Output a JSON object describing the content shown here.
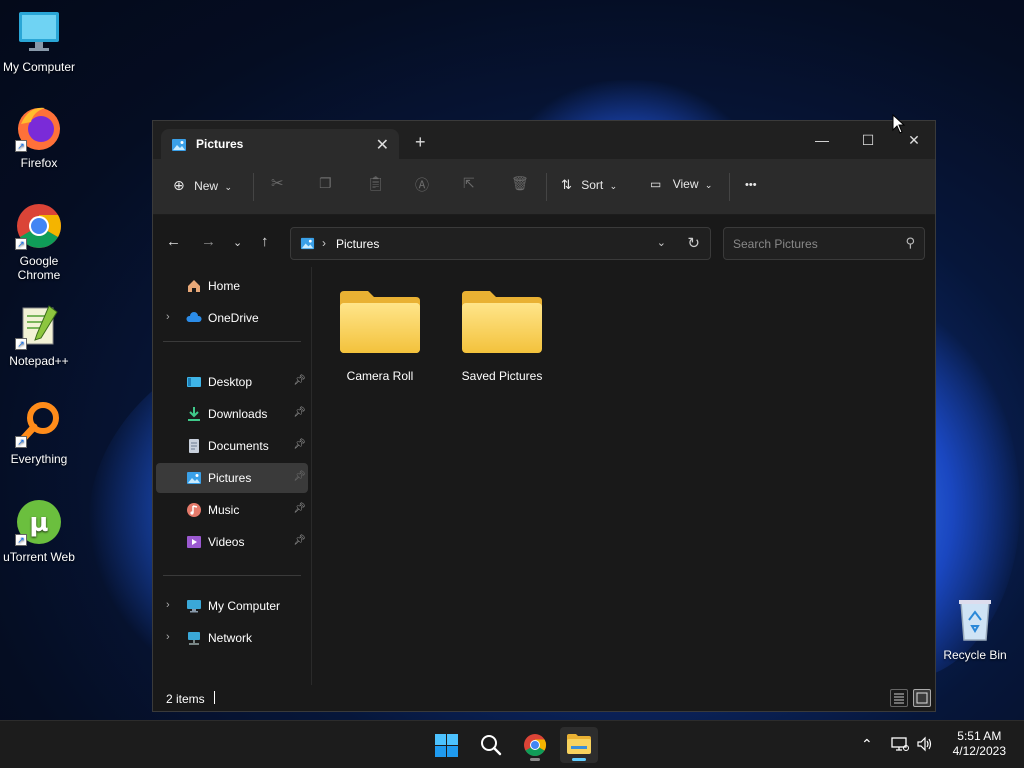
{
  "desktop": {
    "icons": [
      {
        "label": "My Computer"
      },
      {
        "label": "Firefox"
      },
      {
        "label": "Google Chrome"
      },
      {
        "label": "Notepad++"
      },
      {
        "label": "Everything"
      },
      {
        "label": "uTorrent Web"
      },
      {
        "label": "Recycle Bin"
      }
    ]
  },
  "window": {
    "tab_title": "Pictures",
    "toolbar": {
      "new_label": "New",
      "sort_label": "Sort",
      "view_label": "View",
      "more_label": "•••"
    },
    "address": {
      "crumb": "Pictures"
    },
    "search": {
      "placeholder": "Search Pictures"
    },
    "nav": {
      "items": [
        {
          "label": "Home"
        },
        {
          "label": "OneDrive"
        },
        {
          "label": "Desktop"
        },
        {
          "label": "Downloads"
        },
        {
          "label": "Documents"
        },
        {
          "label": "Pictures"
        },
        {
          "label": "Music"
        },
        {
          "label": "Videos"
        },
        {
          "label": "My Computer"
        },
        {
          "label": "Network"
        }
      ]
    },
    "folders": [
      {
        "label": "Camera Roll"
      },
      {
        "label": "Saved Pictures"
      }
    ],
    "status": {
      "count": "2 items"
    }
  },
  "taskbar": {
    "time": "5:51 AM",
    "date": "4/12/2023"
  },
  "colors": {
    "accent": "#60cdff",
    "folder": "#f7c94a",
    "selected": "#3a3a3a"
  }
}
